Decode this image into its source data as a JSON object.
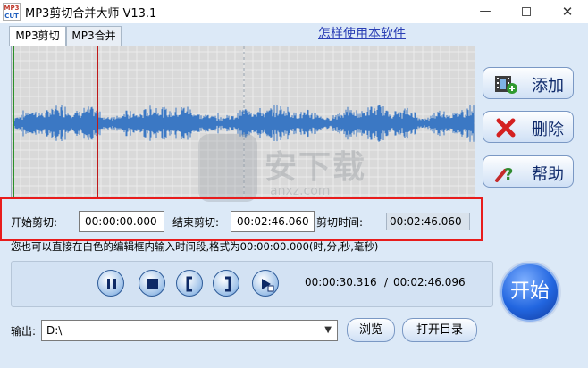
{
  "window": {
    "title": "MP3剪切合并大师 V13.1",
    "logo_line1": "MP3",
    "logo_line2": "CUT",
    "min_glyph": "—",
    "close_glyph": "✕"
  },
  "tabs": [
    {
      "label": "MP3剪切",
      "active": true
    },
    {
      "label": "MP3合并",
      "active": false
    }
  ],
  "help_link": "怎样使用本软件",
  "side_buttons": {
    "add": {
      "label": "添加",
      "icon": "film-add-icon"
    },
    "delete": {
      "label": "删除",
      "icon": "red-x-icon"
    },
    "help": {
      "label": "帮助",
      "icon": "question-icon"
    }
  },
  "time_panel": {
    "start_label": "开始剪切:",
    "start_value": "00:00:00.000",
    "end_label": "结束剪切:",
    "end_value": "00:02:46.060",
    "cut_label": "剪切时间:",
    "cut_value": "00:02:46.060"
  },
  "hint": "您也可以直接在白色的编辑框内输入时间段,格式为00:00:00.000(时,分,秒,毫秒)",
  "player": {
    "current_time": "00:00:30.316",
    "separator": "/",
    "total_time": "00:02:46.096",
    "buttons": [
      "pause-icon",
      "stop-icon",
      "mark-in-icon",
      "mark-out-icon",
      "play-icon"
    ]
  },
  "start_button": "开始",
  "output": {
    "label": "输出:",
    "value": "D:\\",
    "browse": "浏览",
    "open_dir": "打开目录"
  },
  "watermark": {
    "text": "安下载",
    "sub": "anxz.com"
  },
  "colors": {
    "waveform": "#3b78c4",
    "playhead": "#c01818",
    "highlight_frame": "#e81c1c",
    "start_marker": "#2a8f2a"
  }
}
